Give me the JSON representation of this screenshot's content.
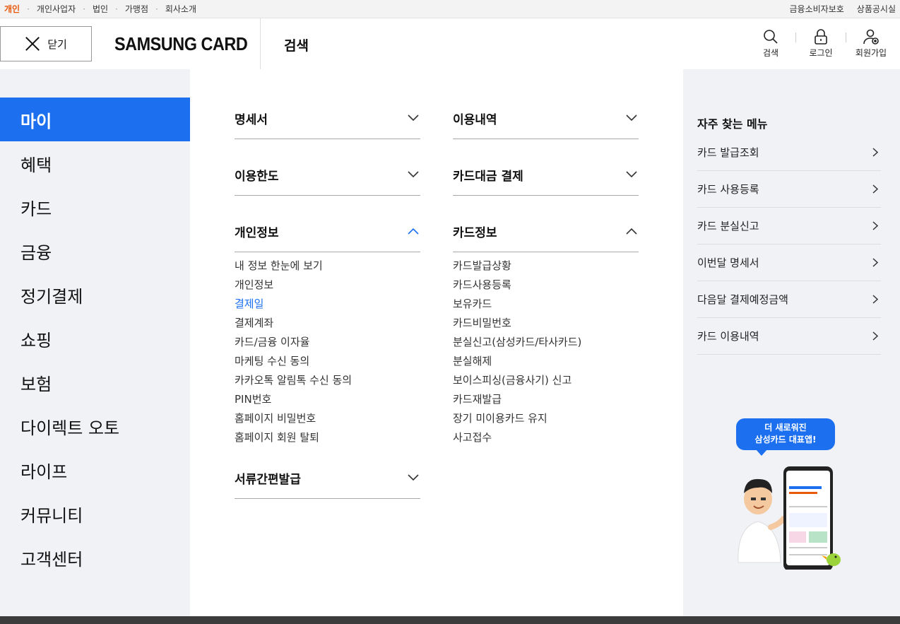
{
  "util_bar": {
    "left_items": [
      "개인",
      "개인사업자",
      "법인",
      "가맹점",
      "회사소개"
    ],
    "active": "개인",
    "right_items": [
      "금융소비자보호",
      "상품공시실"
    ]
  },
  "header": {
    "close_label": "닫기",
    "logo": "SAMSUNG CARD",
    "search_title": "검색",
    "icons": [
      {
        "label": "검색",
        "icon": "search-icon"
      },
      {
        "label": "로그인",
        "icon": "lock-icon"
      },
      {
        "label": "회원가입",
        "icon": "user-add-icon"
      }
    ]
  },
  "leftnav": {
    "items": [
      "마이",
      "혜택",
      "카드",
      "금융",
      "정기결제",
      "쇼핑",
      "보험",
      "다이렉트 오토",
      "라이프",
      "커뮤니티",
      "고객센터"
    ],
    "active_index": 0
  },
  "menu": {
    "col1": [
      {
        "title": "명세서",
        "expanded": false
      },
      {
        "title": "이용한도",
        "expanded": false
      },
      {
        "title": "개인정보",
        "expanded": true,
        "items": [
          "내 정보 한눈에 보기",
          "개인정보",
          "결제일",
          "결제계좌",
          "카드/금융 이자율",
          "마케팅 수신 동의",
          "카카오톡 알림톡 수신 동의",
          "PIN번호",
          "홈페이지 비밀번호",
          "홈페이지 회원 탈퇴"
        ],
        "active_item": "결제일"
      },
      {
        "title": "서류간편발급",
        "expanded": false
      }
    ],
    "col2": [
      {
        "title": "이용내역",
        "expanded": false
      },
      {
        "title": "카드대금 결제",
        "expanded": false
      },
      {
        "title": "카드정보",
        "expanded": true,
        "items": [
          "카드발급상황",
          "카드사용등록",
          "보유카드",
          "카드비밀번호",
          "분실신고(삼성카드/타사카드)",
          "분실해제",
          "보이스피싱(금융사기) 신고",
          "카드재발급",
          "장기 미이용카드 유지",
          "사고접수"
        ]
      }
    ]
  },
  "frequent": {
    "title": "자주 찾는 메뉴",
    "items": [
      "카드 발급조회",
      "카드 사용등록",
      "카드 분실신고",
      "이번달 명세서",
      "다음달 결제예정금액",
      "카드 이용내역"
    ]
  },
  "promo": {
    "line1": "더 새로워진",
    "line2": "삼성카드 대표앱!"
  },
  "colors": {
    "accent": "#1c70f0",
    "util_active": "#e8590c",
    "panel_bg": "#f1f2f6"
  }
}
